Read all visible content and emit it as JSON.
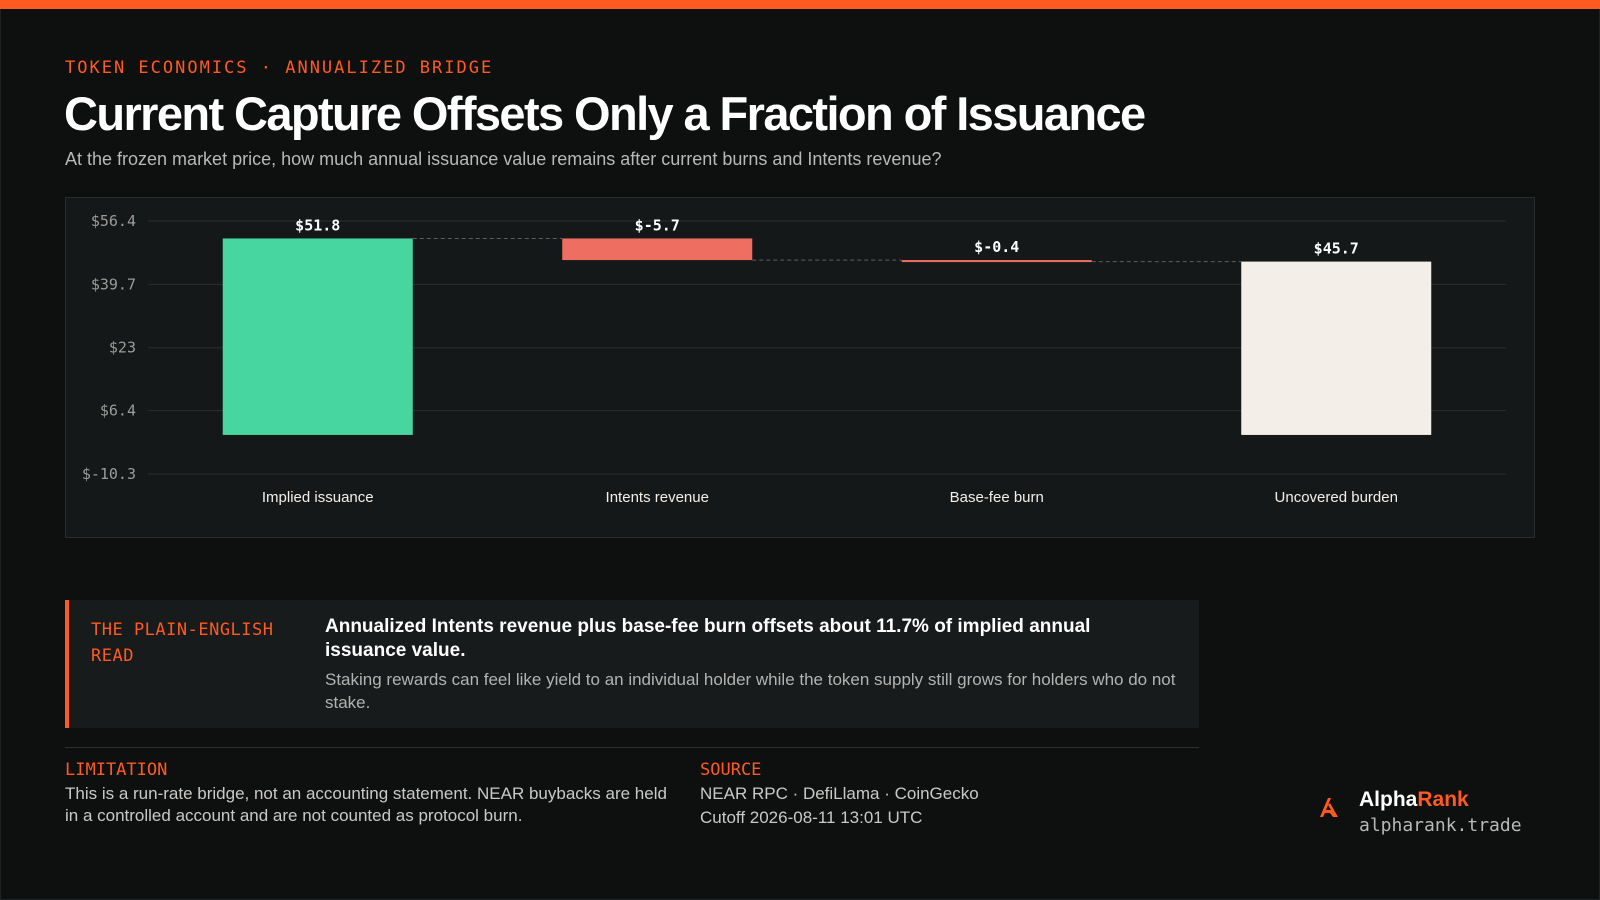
{
  "header": {
    "kicker": "TOKEN ECONOMICS · ANNUALIZED BRIDGE",
    "title": "Current Capture Offsets Only a Fraction of Issuance",
    "subtitle": "At the frozen market price, how much annual issuance value remains after current burns and Intents revenue?"
  },
  "chart_data": {
    "type": "bar",
    "subtype": "waterfall",
    "categories": [
      "Implied issuance",
      "Intents revenue",
      "Base-fee burn",
      "Uncovered burden"
    ],
    "values": [
      51.8,
      -5.7,
      -0.4,
      45.7
    ],
    "data_labels": [
      "$51.8",
      "$-5.7",
      "$-0.4",
      "$45.7"
    ],
    "y_ticks": [
      56.4,
      39.7,
      23,
      6.4,
      -10.3
    ],
    "y_tick_labels": [
      "$56.4",
      "$39.7",
      "$23",
      "$6.4",
      "$-10.3"
    ],
    "ylim": [
      -10.3,
      56.4
    ],
    "grid": true,
    "colors": {
      "increase": "#47d6a0",
      "decrease": "#ee6f62",
      "total": "#f3eee8",
      "grid": "#2a2e2e",
      "connector": "#5a5e5e"
    }
  },
  "plain_read": {
    "label": "THE PLAIN-ENGLISH READ",
    "headline": "Annualized Intents revenue plus base-fee burn offsets about 11.7% of implied annual issuance value.",
    "body": "Staking rewards can feel like yield to an individual holder while the token supply still grows for holders who do not stake."
  },
  "limitation": {
    "label": "LIMITATION",
    "text": "This is a run-rate bridge, not an accounting statement. NEAR buybacks are held in a controlled account and are not counted as protocol burn."
  },
  "source": {
    "label": "SOURCE",
    "line1": "NEAR RPC · DefiLlama · CoinGecko",
    "line2": "Cutoff 2026-08-11 13:01 UTC"
  },
  "brand": {
    "name_part1": "Alpha",
    "name_part2": "Rank",
    "url": "alpharank.trade",
    "icon": "alpharank-logo-icon",
    "accent_color": "#ff5a1f"
  }
}
